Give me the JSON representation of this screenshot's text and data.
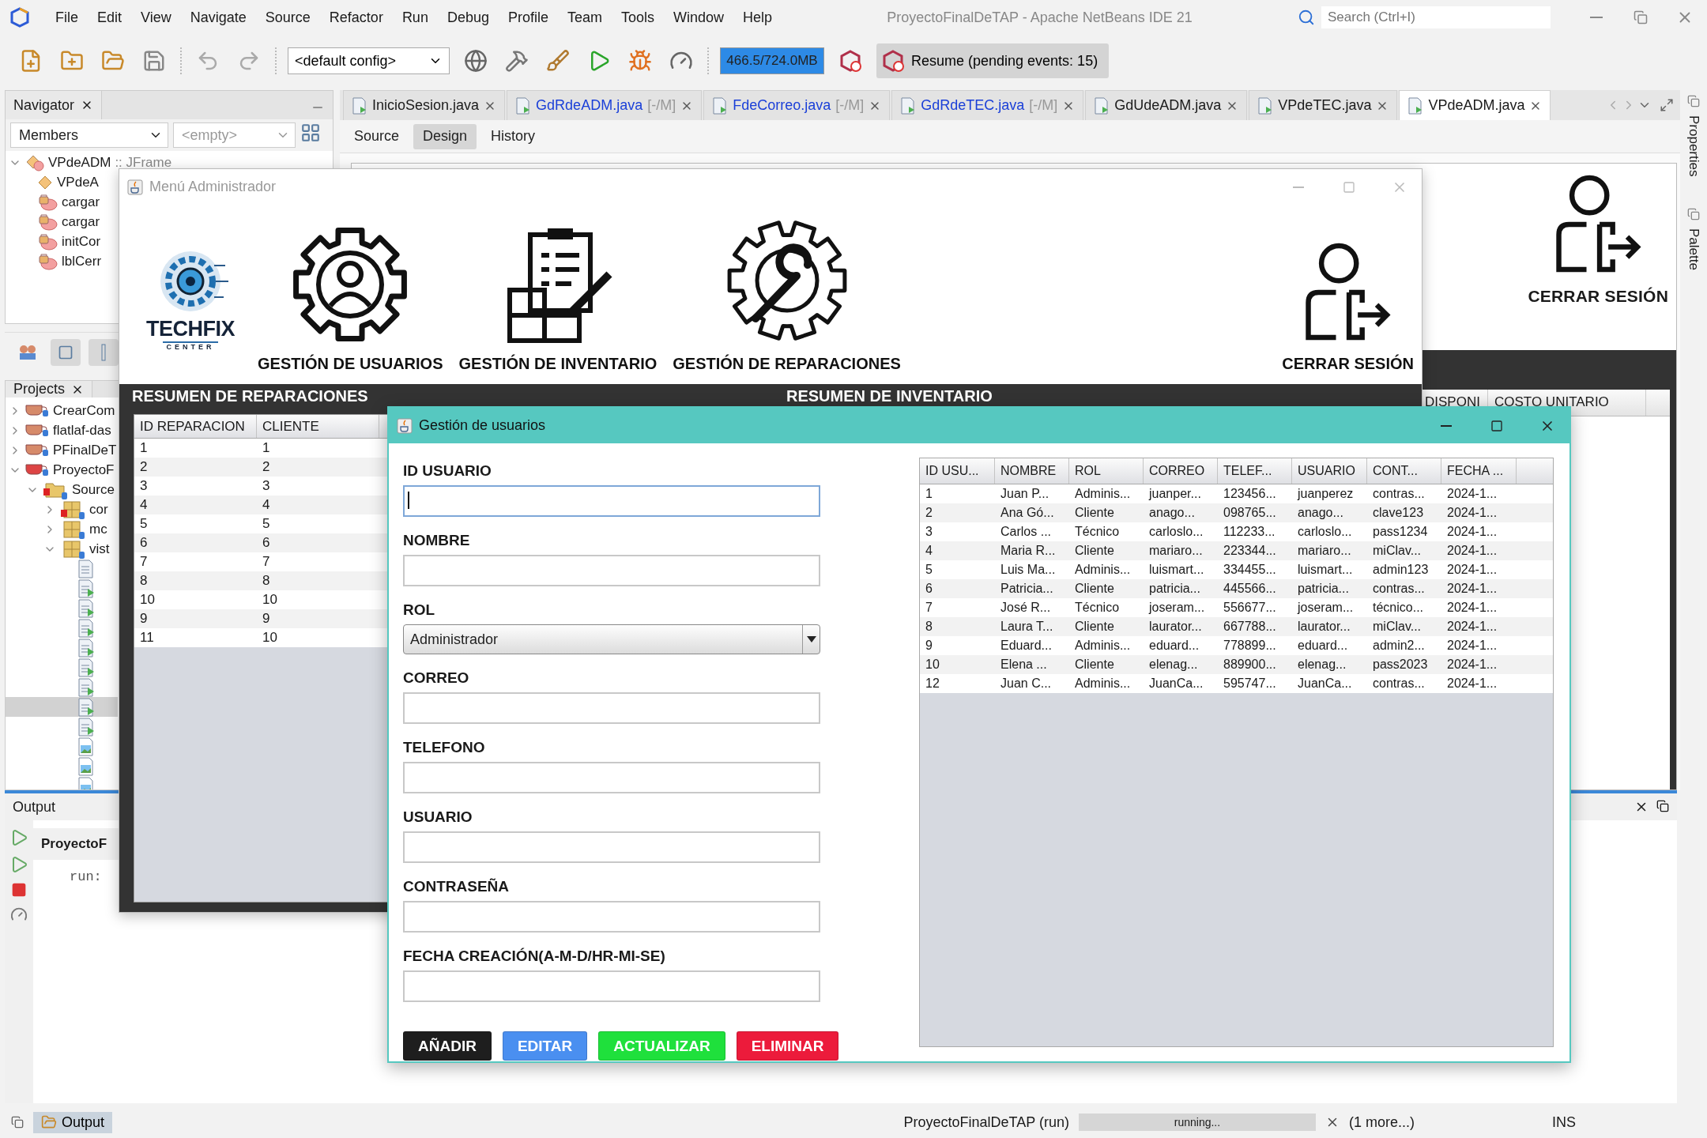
{
  "ide": {
    "title": "ProyectoFinalDeTAP - Apache NetBeans IDE 21",
    "menu": [
      "File",
      "Edit",
      "View",
      "Navigate",
      "Source",
      "Refactor",
      "Run",
      "Debug",
      "Profile",
      "Team",
      "Tools",
      "Window",
      "Help"
    ],
    "search": {
      "placeholder": "Search (Ctrl+I)"
    },
    "config": "<default config>",
    "memory": {
      "text": "466.5/724.0MB",
      "level": 1
    },
    "resume": "Resume (pending events: 15)"
  },
  "navigator": {
    "title": "Navigator",
    "filter": "Members",
    "scope": "<empty>",
    "items": [
      {
        "label": "VPdeADM",
        "suffix": ":: JFrame",
        "kind": "class",
        "expanded": true,
        "children": [
          {
            "label": "VPdeA",
            "kind": "constructor"
          },
          {
            "label": "cargar",
            "kind": "method"
          },
          {
            "label": "cargar",
            "kind": "method"
          },
          {
            "label": "initCor",
            "kind": "method"
          },
          {
            "label": "lblCerr",
            "kind": "method"
          }
        ]
      }
    ]
  },
  "projects": {
    "title": "Projects",
    "items": [
      {
        "label": "CrearCom",
        "kind": "project",
        "expanded": false,
        "selected": false
      },
      {
        "label": "flatlaf-das",
        "kind": "project",
        "expanded": false,
        "selected": false
      },
      {
        "label": "PFinalDeT",
        "kind": "project",
        "expanded": false,
        "selected": false
      },
      {
        "label": "ProyectoF",
        "kind": "project-error",
        "expanded": true,
        "selected": false,
        "children": [
          {
            "label": "Source",
            "kind": "sources",
            "expanded": true,
            "selected": false,
            "children": [
              {
                "label": "cor",
                "kind": "package-error",
                "expanded": false,
                "selected": false
              },
              {
                "label": "mc",
                "kind": "package",
                "expanded": false,
                "selected": false
              },
              {
                "label": "vist",
                "kind": "package",
                "expanded": true,
                "selected": false,
                "children": [
                  {
                    "kind": "form",
                    "selected": false
                  },
                  {
                    "kind": "form-main",
                    "selected": false
                  },
                  {
                    "kind": "form-main",
                    "selected": false
                  },
                  {
                    "kind": "form-main",
                    "selected": false
                  },
                  {
                    "kind": "form-main",
                    "selected": false
                  },
                  {
                    "kind": "form-main",
                    "selected": false
                  },
                  {
                    "kind": "form-main",
                    "selected": false
                  },
                  {
                    "kind": "form-main",
                    "selected": true
                  },
                  {
                    "kind": "form-main",
                    "selected": false
                  },
                  {
                    "kind": "image",
                    "selected": false
                  },
                  {
                    "kind": "image",
                    "selected": false
                  },
                  {
                    "kind": "image",
                    "selected": false
                  }
                ]
              }
            ]
          }
        ]
      }
    ]
  },
  "editor_tabs": [
    {
      "label": "InicioSesion.java",
      "modified": false,
      "selected": false
    },
    {
      "label": "GdRdeADM.java",
      "mark": "[-/M]",
      "modified": true,
      "selected": false
    },
    {
      "label": "FdeCorreo.java",
      "mark": "[-/M]",
      "modified": true,
      "selected": false
    },
    {
      "label": "GdRdeTEC.java",
      "mark": "[-/M]",
      "modified": true,
      "selected": false
    },
    {
      "label": "GdUdeADM.java",
      "modified": false,
      "selected": false
    },
    {
      "label": "VPdeTEC.java",
      "modified": false,
      "selected": false
    },
    {
      "label": "VPdeADM.java",
      "modified": false,
      "selected": true
    }
  ],
  "editor_modes": [
    {
      "label": "Source",
      "selected": false
    },
    {
      "label": "Design",
      "selected": true
    },
    {
      "label": "History",
      "selected": false
    }
  ],
  "design_preview": {
    "logout": "CERRAR SESIÓN",
    "columns": [
      "DISPONI",
      "COSTO UNITARIO"
    ]
  },
  "side_tabs": [
    "Properties",
    "Palette"
  ],
  "output": {
    "title": "Output",
    "tab": "ProyectoF",
    "text": "run:"
  },
  "status_bar": {
    "output": "Output",
    "task": "ProyectoFinalDeTAP (run)",
    "progress": {
      "text": "running...",
      "level": 1
    },
    "more": "(1 more...)",
    "mode": "INS"
  },
  "admin_window": {
    "title": "Menú Administrador",
    "logo": {
      "name": "TECHFIX",
      "tagline": "CENTER"
    },
    "menu": [
      {
        "label": "GESTIÓN DE USUARIOS",
        "kind": "users"
      },
      {
        "label": "GESTIÓN DE INVENTARIO",
        "kind": "inventory"
      },
      {
        "label": "GESTIÓN DE REPARACIONES",
        "kind": "repairs"
      }
    ],
    "logout": "CERRAR SESIÓN",
    "repairs": {
      "title": "RESUMEN DE REPARACIONES",
      "columns": [
        "ID REPARACION",
        "CLIENTE"
      ],
      "rows": [
        [
          "1",
          "1"
        ],
        [
          "2",
          "2"
        ],
        [
          "3",
          "3"
        ],
        [
          "4",
          "4"
        ],
        [
          "5",
          "5"
        ],
        [
          "6",
          "6"
        ],
        [
          "7",
          "7"
        ],
        [
          "8",
          "8"
        ],
        [
          "10",
          "10"
        ],
        [
          "9",
          "9"
        ],
        [
          "11",
          "10"
        ]
      ]
    },
    "inventory": {
      "title": "RESUMEN DE INVENTARIO"
    }
  },
  "users_dialog": {
    "title": "Gestión de usuarios",
    "fields": [
      {
        "label": "ID USUARIO",
        "kind": "text",
        "focused": true
      },
      {
        "label": "NOMBRE",
        "kind": "text",
        "focused": false
      },
      {
        "label": "ROL",
        "kind": "select",
        "value": "Administrador",
        "focused": false
      },
      {
        "label": "CORREO",
        "kind": "text",
        "focused": false
      },
      {
        "label": "TELEFONO",
        "kind": "text",
        "focused": false
      },
      {
        "label": "USUARIO",
        "kind": "text",
        "focused": false
      },
      {
        "label": "CONTRASEÑA",
        "kind": "text",
        "focused": false
      },
      {
        "label": "FECHA CREACIÓN(A-M-D/HR-MI-SE)",
        "kind": "text",
        "focused": false
      }
    ],
    "buttons": [
      {
        "label": "AÑADIR",
        "color": "#1e1e1e"
      },
      {
        "label": "EDITAR",
        "color": "#4a8ff0"
      },
      {
        "label": "ACTUALIZAR",
        "color": "#1fe03c"
      },
      {
        "label": "ELIMINAR",
        "color": "#ec1b3b"
      }
    ],
    "table": {
      "columns": [
        "ID USU...",
        "NOMBRE",
        "ROL",
        "CORREO",
        "TELEF...",
        "USUARIO",
        "CONT...",
        "FECHA ..."
      ],
      "rows": [
        [
          "1",
          "Juan P...",
          "Adminis...",
          "juanper...",
          "123456...",
          "juanperez",
          "contras...",
          "2024-1..."
        ],
        [
          "2",
          "Ana Gó...",
          "Cliente",
          "anago...",
          "098765...",
          "anago...",
          "clave123",
          "2024-1..."
        ],
        [
          "3",
          "Carlos ...",
          "Técnico",
          "carloslo...",
          "112233...",
          "carloslo...",
          "pass1234",
          "2024-1..."
        ],
        [
          "4",
          "Maria R...",
          "Cliente",
          "mariaro...",
          "223344...",
          "mariaro...",
          "miClav...",
          "2024-1..."
        ],
        [
          "5",
          "Luis Ma...",
          "Adminis...",
          "luismart...",
          "334455...",
          "luismart...",
          "admin123",
          "2024-1..."
        ],
        [
          "6",
          "Patricia...",
          "Cliente",
          "patricia...",
          "445566...",
          "patricia...",
          "contras...",
          "2024-1..."
        ],
        [
          "7",
          "José R...",
          "Técnico",
          "joseram...",
          "556677...",
          "joseram...",
          "técnico...",
          "2024-1..."
        ],
        [
          "8",
          "Laura T...",
          "Cliente",
          "laurator...",
          "667788...",
          "laurator...",
          "miClav...",
          "2024-1..."
        ],
        [
          "9",
          "Eduard...",
          "Adminis...",
          "eduard...",
          "778899...",
          "eduard...",
          "admin2...",
          "2024-1..."
        ],
        [
          "10",
          "Elena ...",
          "Cliente",
          "elenag...",
          "889900...",
          "elenag...",
          "pass2023",
          "2024-1..."
        ],
        [
          "12",
          "Juan C...",
          "Adminis...",
          "JuanCa...",
          "595747...",
          "JuanCa...",
          "contras...",
          "2024-1..."
        ]
      ]
    }
  }
}
